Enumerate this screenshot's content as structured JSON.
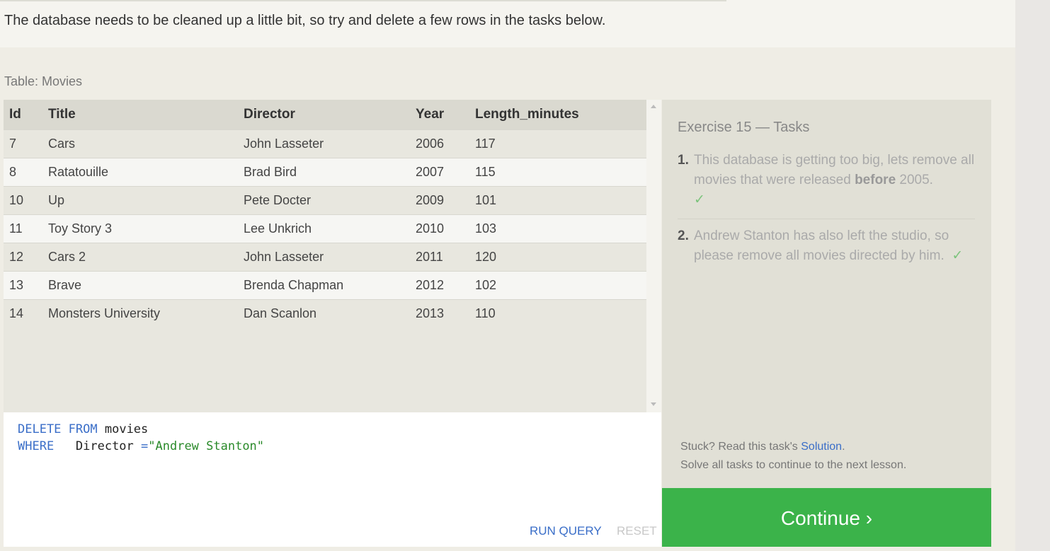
{
  "intro_text": "The database needs to be cleaned up a little bit, so try and delete a few rows in the tasks below.",
  "table_caption": "Table: Movies",
  "table": {
    "headers": [
      "Id",
      "Title",
      "Director",
      "Year",
      "Length_minutes"
    ],
    "rows": [
      [
        "7",
        "Cars",
        "John Lasseter",
        "2006",
        "117"
      ],
      [
        "8",
        "Ratatouille",
        "Brad Bird",
        "2007",
        "115"
      ],
      [
        "10",
        "Up",
        "Pete Docter",
        "2009",
        "101"
      ],
      [
        "11",
        "Toy Story 3",
        "Lee Unkrich",
        "2010",
        "103"
      ],
      [
        "12",
        "Cars 2",
        "John Lasseter",
        "2011",
        "120"
      ],
      [
        "13",
        "Brave",
        "Brenda Chapman",
        "2012",
        "102"
      ],
      [
        "14",
        "Monsters University",
        "Dan Scanlon",
        "2013",
        "110"
      ]
    ]
  },
  "editor": {
    "line1": {
      "kw1": "DELETE",
      "kw2": "FROM",
      "rest": " movies"
    },
    "line2": {
      "kw": "WHERE",
      "mid": "   Director ",
      "op": "=",
      "str": "\"Andrew Stanton\""
    },
    "run_label": "RUN QUERY",
    "reset_label": "RESET"
  },
  "tasks": {
    "heading": "Exercise 15 — Tasks",
    "items": [
      {
        "num": "1.",
        "pre": "This database is getting too big, lets remove all movies that were released ",
        "bold": "before",
        "post": " 2005.",
        "check": "✓"
      },
      {
        "num": "2.",
        "text": "Andrew Stanton has also left the studio, so please remove all movies directed by him.",
        "check": "✓"
      }
    ],
    "stuck_prefix": "Stuck? Read this task's ",
    "solution_link": "Solution",
    "stuck_suffix": ".",
    "progress_note": "Solve all tasks to continue to the next lesson."
  },
  "continue_label": "Continue ›",
  "colors": {
    "accent_green": "#3bb34a",
    "link_blue": "#3a6ec8"
  }
}
